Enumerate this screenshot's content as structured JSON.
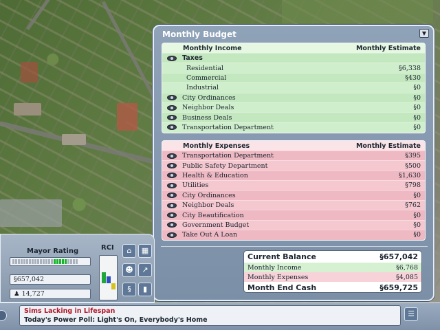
{
  "budget": {
    "title": "Monthly Budget",
    "collapse_icon": "chevron-down-icon",
    "income": {
      "header_label": "Monthly Income",
      "header_estimate": "Monthly Estimate",
      "rows": [
        {
          "label": "Taxes",
          "value": "",
          "eye": true,
          "sub": false,
          "bold": true
        },
        {
          "label": "Residential",
          "value": "§6,338",
          "eye": false,
          "sub": true
        },
        {
          "label": "Commercial",
          "value": "§430",
          "eye": false,
          "sub": true
        },
        {
          "label": "Industrial",
          "value": "§0",
          "eye": false,
          "sub": true
        },
        {
          "label": "City Ordinances",
          "value": "§0",
          "eye": true,
          "sub": false
        },
        {
          "label": "Neighbor Deals",
          "value": "§0",
          "eye": true,
          "sub": false
        },
        {
          "label": "Business Deals",
          "value": "§0",
          "eye": true,
          "sub": false
        },
        {
          "label": "Transportation Department",
          "value": "§0",
          "eye": true,
          "sub": false
        }
      ]
    },
    "expenses": {
      "header_label": "Monthly Expenses",
      "header_estimate": "Monthly Estimate",
      "rows": [
        {
          "label": "Transportation Department",
          "value": "§395",
          "eye": true
        },
        {
          "label": "Public Safety Department",
          "value": "§500",
          "eye": true
        },
        {
          "label": "Health & Education",
          "value": "§1,630",
          "eye": true
        },
        {
          "label": "Utilities",
          "value": "§798",
          "eye": true
        },
        {
          "label": "City Ordinances",
          "value": "§0",
          "eye": true
        },
        {
          "label": "Neighbor Deals",
          "value": "§762",
          "eye": true
        },
        {
          "label": "City Beautification",
          "value": "§0",
          "eye": true
        },
        {
          "label": "Government Budget",
          "value": "§0",
          "eye": true
        },
        {
          "label": "Take Out A Loan",
          "value": "§0",
          "eye": true
        }
      ]
    },
    "summary": {
      "current_balance_label": "Current Balance",
      "current_balance": "§657,042",
      "monthly_income_label": "Monthly Income",
      "monthly_income": "§6,768",
      "monthly_expenses_label": "Monthly Expenses",
      "monthly_expenses": "§4,085",
      "month_end_label": "Month End Cash",
      "month_end": "§659,725"
    }
  },
  "control": {
    "mayor_rating_label": "Mayor Rating",
    "rating_ticks_total": 24,
    "rating_ticks_on": 5,
    "rating_ticks_start": 15,
    "funds": "§657,042",
    "population": "14,727",
    "population_icon": "person-icon",
    "rci_label": "RCI",
    "rci": {
      "residential": 0.55,
      "commercial": 0.35,
      "industrial": -0.3
    },
    "rci_colors": {
      "residential": "#1fa83a",
      "commercial": "#2f4fbf",
      "industrial": "#d6c21a"
    },
    "tools": [
      {
        "name": "zone-tool-icon",
        "glyph": "⌂"
      },
      {
        "name": "map-grid-icon",
        "glyph": "▦"
      },
      {
        "name": "advisor-icon",
        "glyph": "☻"
      },
      {
        "name": "graph-icon",
        "glyph": "↗"
      },
      {
        "name": "query-icon",
        "glyph": "§"
      },
      {
        "name": "budget-chart-icon",
        "glyph": "▮"
      }
    ]
  },
  "news": {
    "headline": "Sims Lacking in Lifespan",
    "poll": "Today's Power Poll: Light's On, Everybody's Home",
    "menu_icon": "news-list-icon"
  }
}
